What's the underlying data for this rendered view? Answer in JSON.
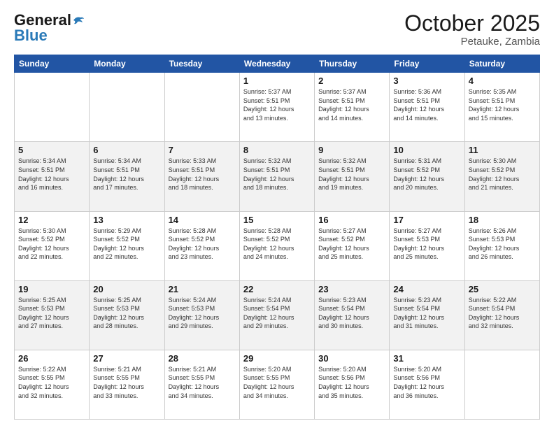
{
  "header": {
    "logo_general": "General",
    "logo_blue": "Blue",
    "month_title": "October 2025",
    "location": "Petauke, Zambia"
  },
  "days_of_week": [
    "Sunday",
    "Monday",
    "Tuesday",
    "Wednesday",
    "Thursday",
    "Friday",
    "Saturday"
  ],
  "weeks": [
    [
      {
        "day": "",
        "info": ""
      },
      {
        "day": "",
        "info": ""
      },
      {
        "day": "",
        "info": ""
      },
      {
        "day": "1",
        "info": "Sunrise: 5:37 AM\nSunset: 5:51 PM\nDaylight: 12 hours\nand 13 minutes."
      },
      {
        "day": "2",
        "info": "Sunrise: 5:37 AM\nSunset: 5:51 PM\nDaylight: 12 hours\nand 14 minutes."
      },
      {
        "day": "3",
        "info": "Sunrise: 5:36 AM\nSunset: 5:51 PM\nDaylight: 12 hours\nand 14 minutes."
      },
      {
        "day": "4",
        "info": "Sunrise: 5:35 AM\nSunset: 5:51 PM\nDaylight: 12 hours\nand 15 minutes."
      }
    ],
    [
      {
        "day": "5",
        "info": "Sunrise: 5:34 AM\nSunset: 5:51 PM\nDaylight: 12 hours\nand 16 minutes."
      },
      {
        "day": "6",
        "info": "Sunrise: 5:34 AM\nSunset: 5:51 PM\nDaylight: 12 hours\nand 17 minutes."
      },
      {
        "day": "7",
        "info": "Sunrise: 5:33 AM\nSunset: 5:51 PM\nDaylight: 12 hours\nand 18 minutes."
      },
      {
        "day": "8",
        "info": "Sunrise: 5:32 AM\nSunset: 5:51 PM\nDaylight: 12 hours\nand 18 minutes."
      },
      {
        "day": "9",
        "info": "Sunrise: 5:32 AM\nSunset: 5:51 PM\nDaylight: 12 hours\nand 19 minutes."
      },
      {
        "day": "10",
        "info": "Sunrise: 5:31 AM\nSunset: 5:52 PM\nDaylight: 12 hours\nand 20 minutes."
      },
      {
        "day": "11",
        "info": "Sunrise: 5:30 AM\nSunset: 5:52 PM\nDaylight: 12 hours\nand 21 minutes."
      }
    ],
    [
      {
        "day": "12",
        "info": "Sunrise: 5:30 AM\nSunset: 5:52 PM\nDaylight: 12 hours\nand 22 minutes."
      },
      {
        "day": "13",
        "info": "Sunrise: 5:29 AM\nSunset: 5:52 PM\nDaylight: 12 hours\nand 22 minutes."
      },
      {
        "day": "14",
        "info": "Sunrise: 5:28 AM\nSunset: 5:52 PM\nDaylight: 12 hours\nand 23 minutes."
      },
      {
        "day": "15",
        "info": "Sunrise: 5:28 AM\nSunset: 5:52 PM\nDaylight: 12 hours\nand 24 minutes."
      },
      {
        "day": "16",
        "info": "Sunrise: 5:27 AM\nSunset: 5:52 PM\nDaylight: 12 hours\nand 25 minutes."
      },
      {
        "day": "17",
        "info": "Sunrise: 5:27 AM\nSunset: 5:53 PM\nDaylight: 12 hours\nand 25 minutes."
      },
      {
        "day": "18",
        "info": "Sunrise: 5:26 AM\nSunset: 5:53 PM\nDaylight: 12 hours\nand 26 minutes."
      }
    ],
    [
      {
        "day": "19",
        "info": "Sunrise: 5:25 AM\nSunset: 5:53 PM\nDaylight: 12 hours\nand 27 minutes."
      },
      {
        "day": "20",
        "info": "Sunrise: 5:25 AM\nSunset: 5:53 PM\nDaylight: 12 hours\nand 28 minutes."
      },
      {
        "day": "21",
        "info": "Sunrise: 5:24 AM\nSunset: 5:53 PM\nDaylight: 12 hours\nand 29 minutes."
      },
      {
        "day": "22",
        "info": "Sunrise: 5:24 AM\nSunset: 5:54 PM\nDaylight: 12 hours\nand 29 minutes."
      },
      {
        "day": "23",
        "info": "Sunrise: 5:23 AM\nSunset: 5:54 PM\nDaylight: 12 hours\nand 30 minutes."
      },
      {
        "day": "24",
        "info": "Sunrise: 5:23 AM\nSunset: 5:54 PM\nDaylight: 12 hours\nand 31 minutes."
      },
      {
        "day": "25",
        "info": "Sunrise: 5:22 AM\nSunset: 5:54 PM\nDaylight: 12 hours\nand 32 minutes."
      }
    ],
    [
      {
        "day": "26",
        "info": "Sunrise: 5:22 AM\nSunset: 5:55 PM\nDaylight: 12 hours\nand 32 minutes."
      },
      {
        "day": "27",
        "info": "Sunrise: 5:21 AM\nSunset: 5:55 PM\nDaylight: 12 hours\nand 33 minutes."
      },
      {
        "day": "28",
        "info": "Sunrise: 5:21 AM\nSunset: 5:55 PM\nDaylight: 12 hours\nand 34 minutes."
      },
      {
        "day": "29",
        "info": "Sunrise: 5:20 AM\nSunset: 5:55 PM\nDaylight: 12 hours\nand 34 minutes."
      },
      {
        "day": "30",
        "info": "Sunrise: 5:20 AM\nSunset: 5:56 PM\nDaylight: 12 hours\nand 35 minutes."
      },
      {
        "day": "31",
        "info": "Sunrise: 5:20 AM\nSunset: 5:56 PM\nDaylight: 12 hours\nand 36 minutes."
      },
      {
        "day": "",
        "info": ""
      }
    ]
  ]
}
